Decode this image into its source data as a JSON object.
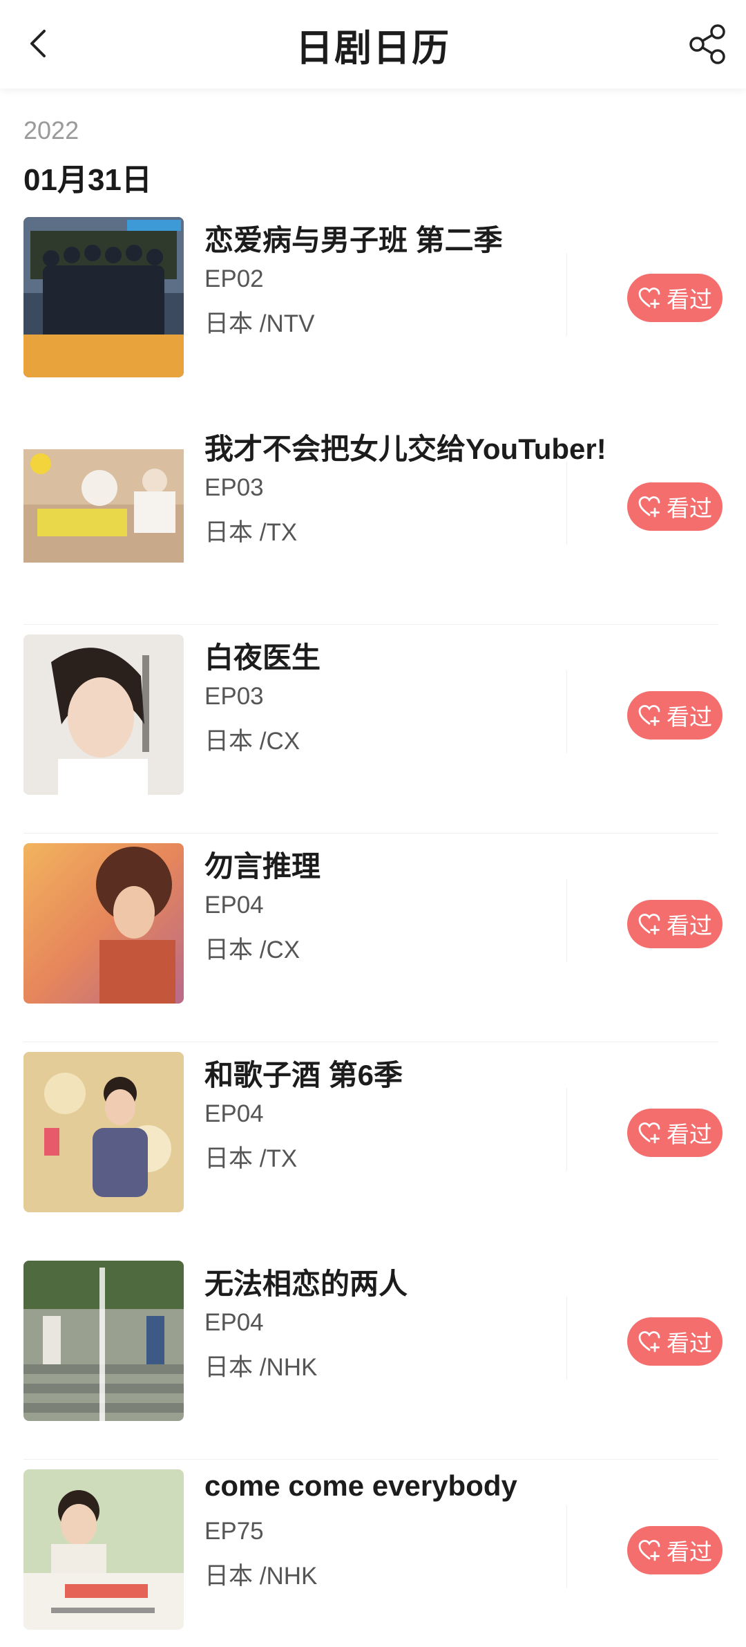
{
  "header": {
    "title": "日剧日历"
  },
  "section": {
    "year": "2022",
    "date": "01月31日"
  },
  "shows": [
    {
      "title": "恋爱病与男子班 第二季",
      "episode": "EP02",
      "network": "日本 /NTV",
      "button": "看过",
      "poster_color": "#6b86b0"
    },
    {
      "title": "我才不会把女儿交给YouTuber!",
      "episode": "EP03",
      "network": "日本 /TX",
      "button": "看过",
      "poster_color": "#b89a78"
    },
    {
      "title": "白夜医生",
      "episode": "EP03",
      "network": "日本 /CX",
      "button": "看过",
      "poster_color": "#e9e4df"
    },
    {
      "title": "勿言推理",
      "episode": "EP04",
      "network": "日本 /CX",
      "button": "看过",
      "poster_color": "#d98a5a"
    },
    {
      "title": "和歌子酒 第6季",
      "episode": "EP04",
      "network": "日本 /TX",
      "button": "看过",
      "poster_color": "#d9c08a"
    },
    {
      "title": "无法相恋的两人",
      "episode": "EP04",
      "network": "日本 /NHK",
      "button": "看过",
      "poster_color": "#8e9488"
    },
    {
      "title": "come come everybody",
      "episode": "EP75",
      "network": "日本 /NHK",
      "button": "看过",
      "poster_color": "#e6e2da"
    }
  ],
  "colors": {
    "accent": "#f46e6e",
    "text": "#1c1c1c",
    "muted": "#9a9a9a"
  }
}
